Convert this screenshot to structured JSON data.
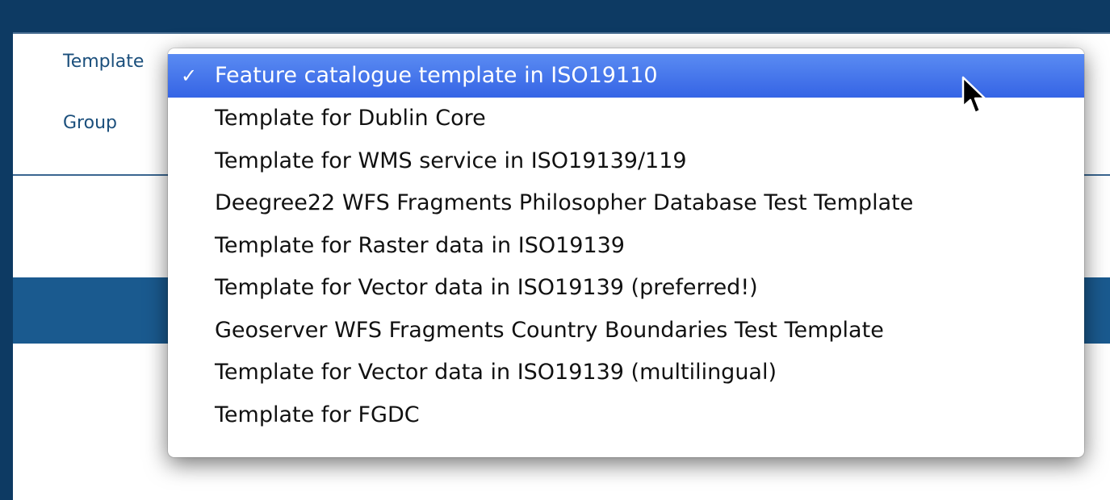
{
  "form": {
    "template_label": "Template",
    "group_label": "Group"
  },
  "dropdown": {
    "selected_index": 0,
    "check_glyph": "✓",
    "options": [
      "Feature catalogue template in ISO19110",
      "Template for Dublin Core",
      "Template for WMS service in ISO19139/119",
      "Deegree22 WFS Fragments Philosopher Database Test Template",
      "Template for Raster data in ISO19139",
      "Template for Vector data in ISO19139 (preferred!)",
      "Geoserver WFS Fragments Country Boundaries Test Template",
      "Template for Vector data in ISO19139 (multilingual)",
      "Template for FGDC"
    ]
  },
  "colors": {
    "frame": "#0d3a63",
    "label": "#1b4f7c",
    "highlight": "#3564e5"
  },
  "icons": {
    "pointer": "mouse-pointer-icon"
  }
}
